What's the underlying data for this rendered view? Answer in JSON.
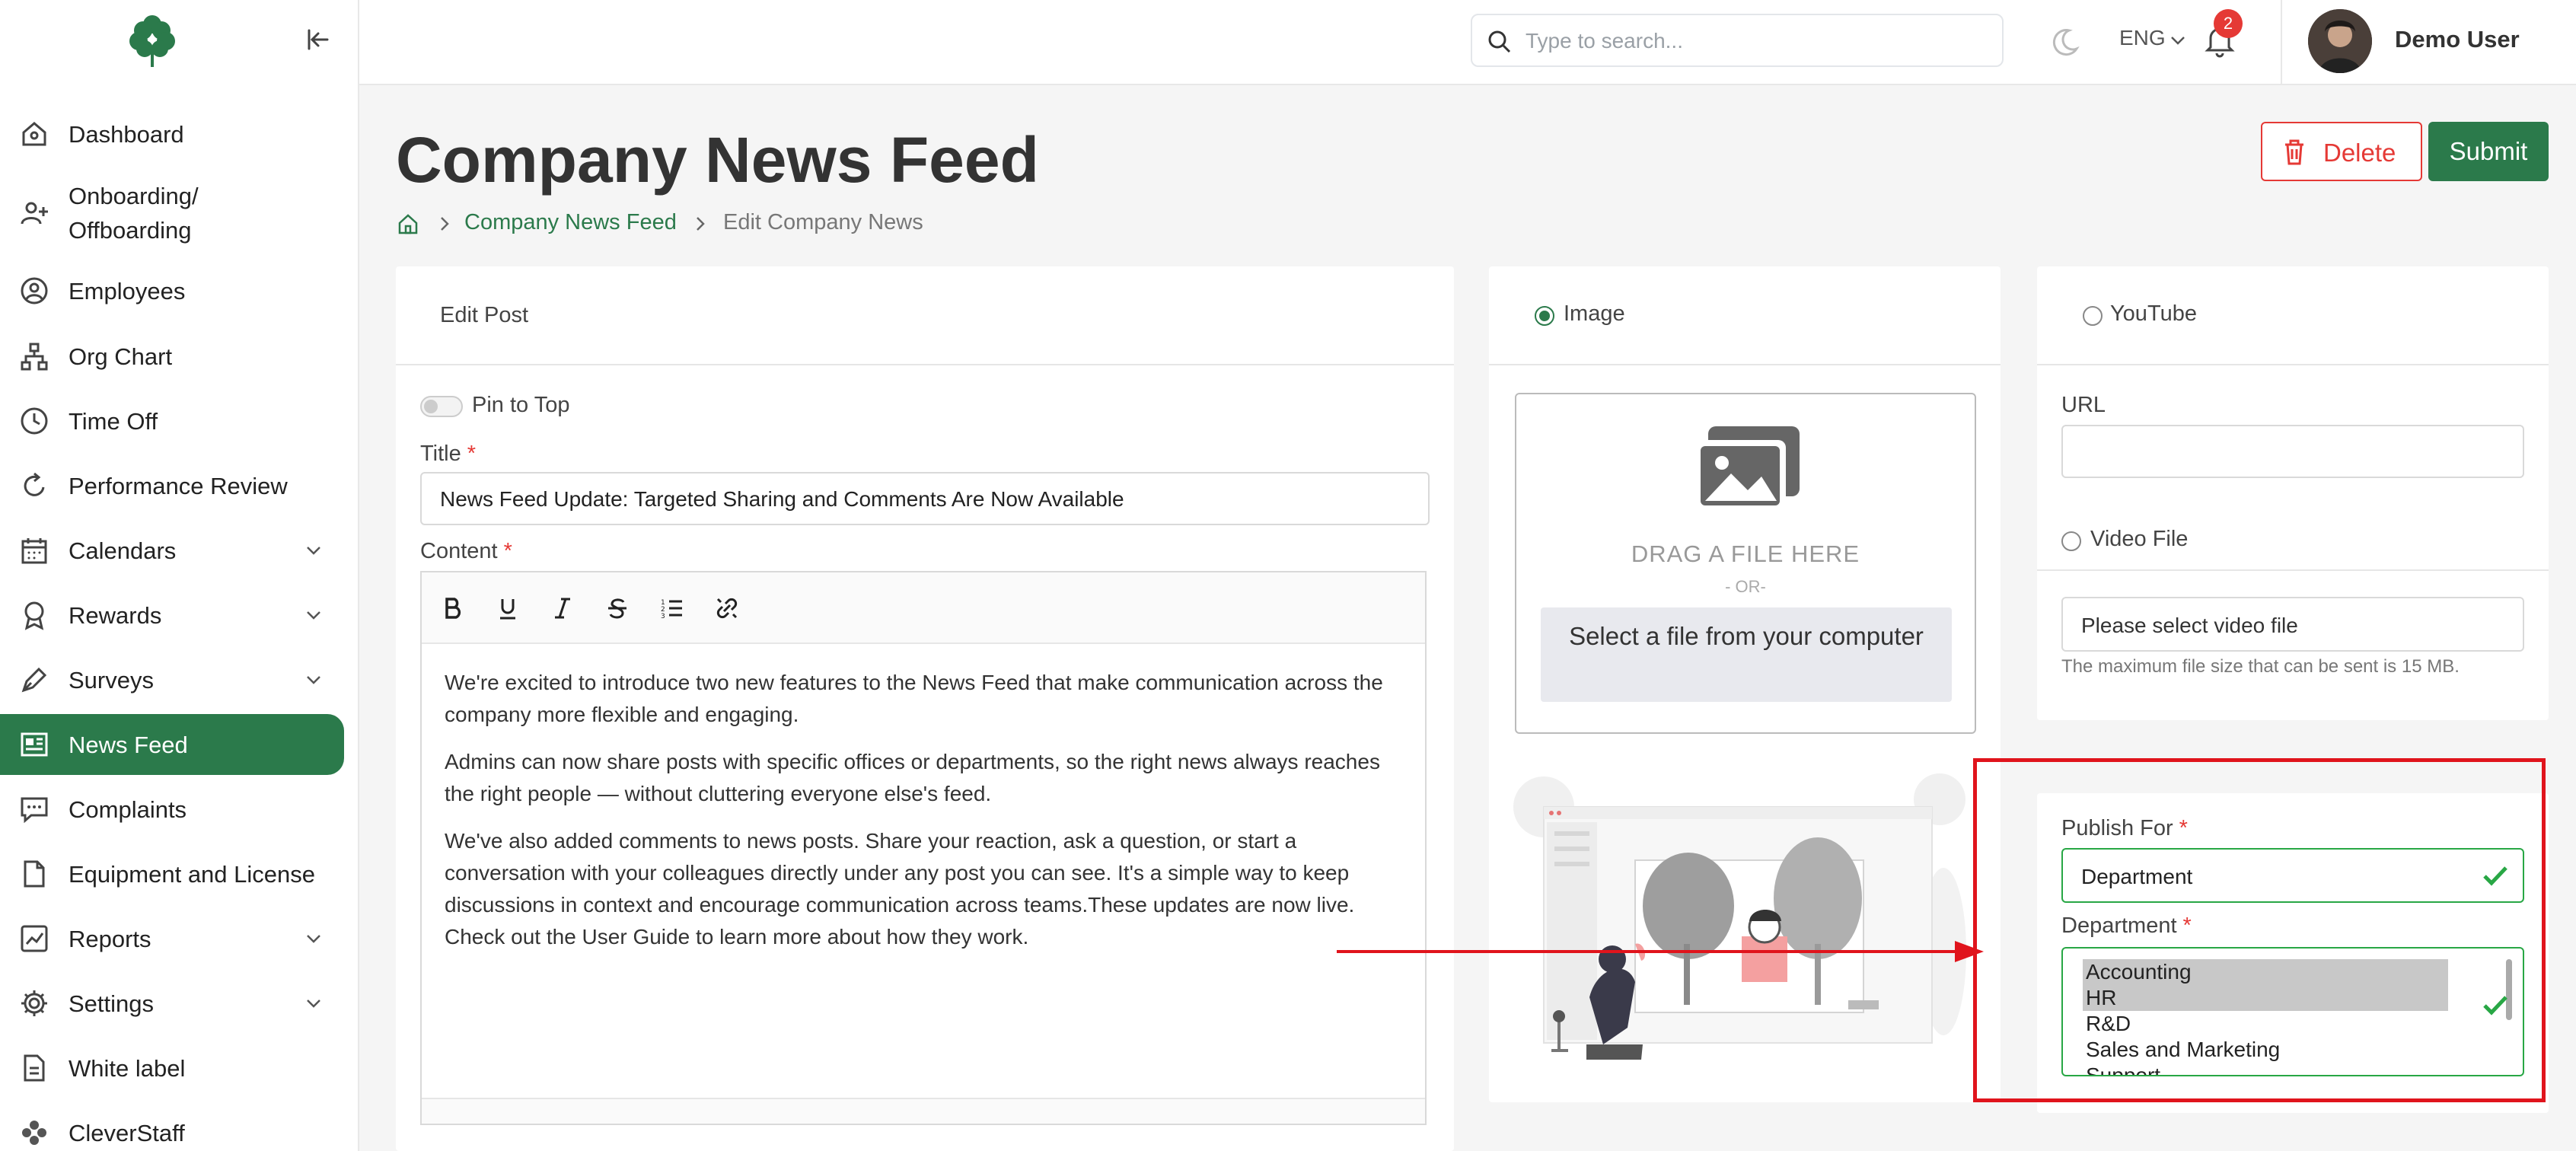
{
  "sidebar": {
    "items": [
      {
        "label": "Dashboard",
        "icon": "home-icon"
      },
      {
        "label": "Onboarding/\nOffboarding",
        "icon": "user-plus-icon"
      },
      {
        "label": "Employees",
        "icon": "user-circle-icon"
      },
      {
        "label": "Org Chart",
        "icon": "org-chart-icon"
      },
      {
        "label": "Time Off",
        "icon": "clock-icon"
      },
      {
        "label": "Performance Review",
        "icon": "refresh-icon"
      },
      {
        "label": "Calendars",
        "icon": "calendar-icon"
      },
      {
        "label": "Rewards",
        "icon": "award-icon"
      },
      {
        "label": "Surveys",
        "icon": "pen-icon"
      },
      {
        "label": "News Feed",
        "icon": "newspaper-icon"
      },
      {
        "label": "Complaints",
        "icon": "chat-icon"
      },
      {
        "label": "Equipment and License",
        "icon": "file-icon"
      },
      {
        "label": "Reports",
        "icon": "chart-icon"
      },
      {
        "label": "Settings",
        "icon": "gear-icon"
      },
      {
        "label": "White label",
        "icon": "document-icon"
      },
      {
        "label": "CleverStaff",
        "icon": "cleverstaff-icon"
      }
    ]
  },
  "topbar": {
    "search_placeholder": "Type to search...",
    "language": "ENG",
    "notification_count": "2",
    "user_name": "Demo User"
  },
  "page": {
    "title": "Company News Feed",
    "breadcrumb_link": "Company News Feed",
    "breadcrumb_current": "Edit Company News",
    "delete_label": "Delete",
    "submit_label": "Submit"
  },
  "edit_card": {
    "header": "Edit Post",
    "pin_label": "Pin to Top",
    "title_label": "Title",
    "title_value": "News Feed Update: Targeted Sharing and Comments Are Now Available",
    "content_label": "Content",
    "required_mark": "*",
    "paragraphs": [
      "We're excited to introduce two new features to the News Feed that make communication across the company more flexible and engaging.",
      "Admins can now share posts with specific offices or departments, so the right news always reaches the right people — without cluttering everyone else's feed.",
      "We've also added comments to news posts. Share your reaction, ask a question, or start a conversation with your colleagues directly under any post you can see. It's a simple way to keep discussions in context and encourage communication across teams.These updates are now live. Check out the User Guide to learn more about how they work."
    ]
  },
  "image_card": {
    "radio_label": "Image",
    "drag_text": "DRAG A FILE HERE",
    "or_text": "- OR-",
    "select_button": "Select a file from your computer"
  },
  "youtube_card": {
    "radio_label": "YouTube",
    "url_label": "URL",
    "video_radio_label": "Video File",
    "video_placeholder": "Please select video file",
    "hint": "The maximum file size that can be sent is 15 MB."
  },
  "publish_card": {
    "publish_label": "Publish For",
    "publish_value": "Department",
    "department_label": "Department",
    "departments": [
      {
        "name": "Accounting",
        "selected": true
      },
      {
        "name": "HR",
        "selected": true
      },
      {
        "name": "R&D",
        "selected": false
      },
      {
        "name": "Sales and Marketing",
        "selected": false
      },
      {
        "name": "Support",
        "selected": false
      }
    ]
  },
  "colors": {
    "brand_green": "#2b7a4b",
    "danger_red": "#e53935",
    "valid_green": "#28a745",
    "annotation_red": "#e0141c"
  }
}
